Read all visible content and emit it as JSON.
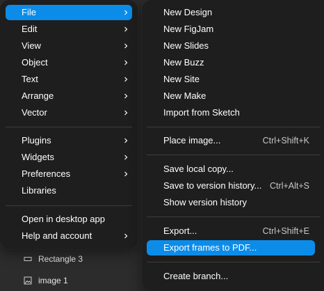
{
  "main_menu": {
    "items": [
      {
        "label": "File",
        "has_submenu": true
      },
      {
        "label": "Edit",
        "has_submenu": true
      },
      {
        "label": "View",
        "has_submenu": true
      },
      {
        "label": "Object",
        "has_submenu": true
      },
      {
        "label": "Text",
        "has_submenu": true
      },
      {
        "label": "Arrange",
        "has_submenu": true
      },
      {
        "label": "Vector",
        "has_submenu": true
      },
      {
        "label": "Plugins",
        "has_submenu": true
      },
      {
        "label": "Widgets",
        "has_submenu": true
      },
      {
        "label": "Preferences",
        "has_submenu": true
      },
      {
        "label": "Libraries",
        "has_submenu": false
      },
      {
        "label": "Open in desktop app",
        "has_submenu": false
      },
      {
        "label": "Help and account",
        "has_submenu": true
      }
    ],
    "active": "File"
  },
  "file_submenu": {
    "items": [
      {
        "label": "New Design",
        "shortcut": ""
      },
      {
        "label": "New FigJam",
        "shortcut": ""
      },
      {
        "label": "New Slides",
        "shortcut": ""
      },
      {
        "label": "New Buzz",
        "shortcut": ""
      },
      {
        "label": "New Site",
        "shortcut": ""
      },
      {
        "label": "New Make",
        "shortcut": ""
      },
      {
        "label": "Import from Sketch",
        "shortcut": ""
      },
      {
        "label": "Place image...",
        "shortcut": "Ctrl+Shift+K"
      },
      {
        "label": "Save local copy...",
        "shortcut": ""
      },
      {
        "label": "Save to version history...",
        "shortcut": "Ctrl+Alt+S"
      },
      {
        "label": "Show version history",
        "shortcut": ""
      },
      {
        "label": "Export...",
        "shortcut": "Ctrl+Shift+E"
      },
      {
        "label": "Export frames to PDF...",
        "shortcut": ""
      },
      {
        "label": "Create branch...",
        "shortcut": ""
      }
    ],
    "highlighted": "Export frames to PDF..."
  },
  "layers_panel": {
    "items": [
      {
        "label": "Rectangle 3",
        "icon": "rectangle-icon"
      },
      {
        "label": "image 1",
        "icon": "image-icon"
      }
    ]
  },
  "colors": {
    "menu_bg": "#1e1e1e",
    "highlight": "#0c8ce9",
    "separator": "#3d3d3d",
    "text": "#ffffff"
  }
}
